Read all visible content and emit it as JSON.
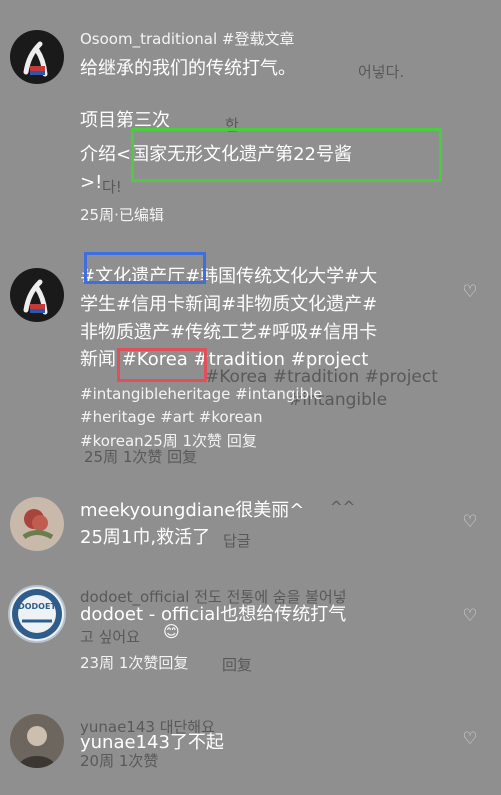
{
  "c1": {
    "user_line": "Osoom_traditional #登载文章",
    "l1": "给继承的我们的传统打气。",
    "l2": "项目第三次",
    "l3": "介绍<国家无形文化遗产第22号酱",
    "l4": ">!",
    "meta": "25周·已编辑",
    "ghost_ko1": "어넣다.",
    "ghost_ko2": "한",
    "ghost_ko3": "다!"
  },
  "c2": {
    "l1": "#文化遗产厅#韩国传统文化大学#大",
    "l2": "学生#信用卡新闻#非物质文化遗产#",
    "l3": "非物质遗产#传统工艺#呼吸#信用卡",
    "l4": "新闻 #Korea #tradition #project",
    "l5": "#intangibleheritage #intangible",
    "l6": "#heritage #art #korean",
    "l7": "#korean25周 1次赞 回复",
    "ghost_a": "#Korea #tradition #project",
    "ghost_b": "#intangible",
    "ghost_c": "25周 1次赞 回复"
  },
  "c3": {
    "l1": "meekyoungdiane很美丽^",
    "l2": "25周1巾,救活了",
    "ghost": "^^",
    "ghost2": "답글"
  },
  "c4": {
    "ghost_user": "dodoet_official 전도 전통에 숨을 불어넣",
    "ghost_user2": "고 싶어요",
    "emoji": "😊",
    "l1": "dodoet - official也想给传统打气",
    "l2": "23周 1次赞回复",
    "ghost_reply": "回复",
    "avatar_text": "DODOET"
  },
  "c5": {
    "ghost_user": "yunae143 대단해요",
    "l1": "yunae143了不起",
    "ghost_meta": "20周 1次赞"
  },
  "icons": {
    "heart": "heart-outline-icon"
  }
}
